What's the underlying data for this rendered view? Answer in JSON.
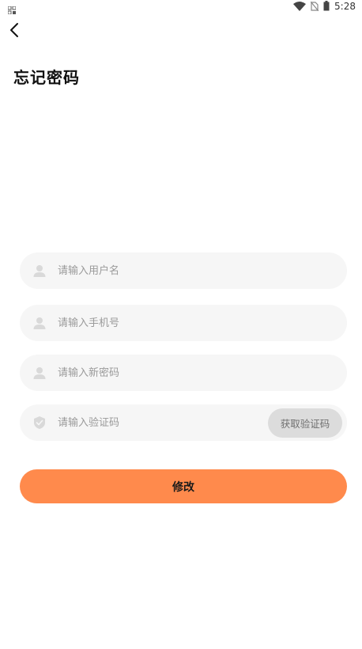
{
  "status_bar": {
    "time": "5:28"
  },
  "header": {
    "title": "忘记密码"
  },
  "form": {
    "username": {
      "value": "",
      "placeholder": "请输入用户名"
    },
    "phone": {
      "value": "",
      "placeholder": "请输入手机号"
    },
    "new_password": {
      "value": "",
      "placeholder": "请输入新密码"
    },
    "verification_code": {
      "value": "",
      "placeholder": "请输入验证码"
    },
    "get_code_label": "获取验证码",
    "submit_label": "修改"
  },
  "colors": {
    "accent": "#ff8a4c",
    "field_bg": "#f6f6f6",
    "code_btn_bg": "#dcdcdc",
    "placeholder": "#9a9a9a"
  },
  "icons": {
    "username": "person-icon",
    "phone": "person-icon",
    "new_password": "person-icon",
    "verification_code": "shield-check-icon"
  }
}
